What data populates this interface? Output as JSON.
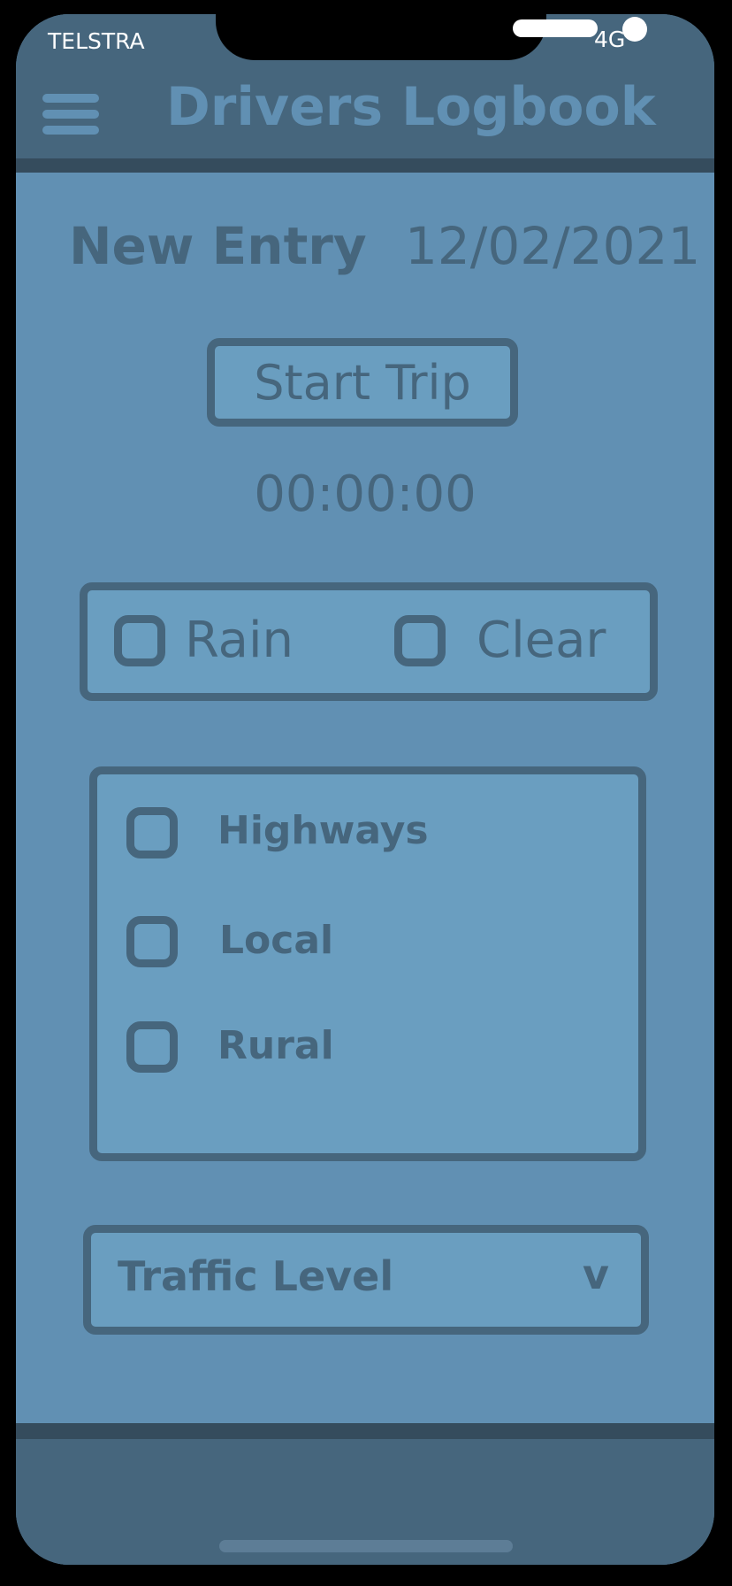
{
  "status_bar": {
    "carrier": "TELSTRA",
    "network": "4G"
  },
  "header": {
    "menu_icon": "hamburger-menu-icon",
    "title": "Drivers Logbook"
  },
  "entry": {
    "title": "New Entry",
    "date": "12/02/2021"
  },
  "trip": {
    "start_label": "Start Trip",
    "timer": "00:00:00"
  },
  "weather": {
    "options": [
      {
        "label": "Rain"
      },
      {
        "label": "Clear"
      }
    ]
  },
  "roads": {
    "options": [
      {
        "label": "Highways"
      },
      {
        "label": "Local"
      },
      {
        "label": "Rural"
      }
    ]
  },
  "traffic": {
    "label": "Traffic Level",
    "chevron": "v"
  },
  "colors": {
    "background": "#6190b3",
    "header": "#46667d",
    "header_divider": "#354c5d",
    "panel": "#6a9ec0",
    "text": "#46667d",
    "title": "#6190b3"
  }
}
